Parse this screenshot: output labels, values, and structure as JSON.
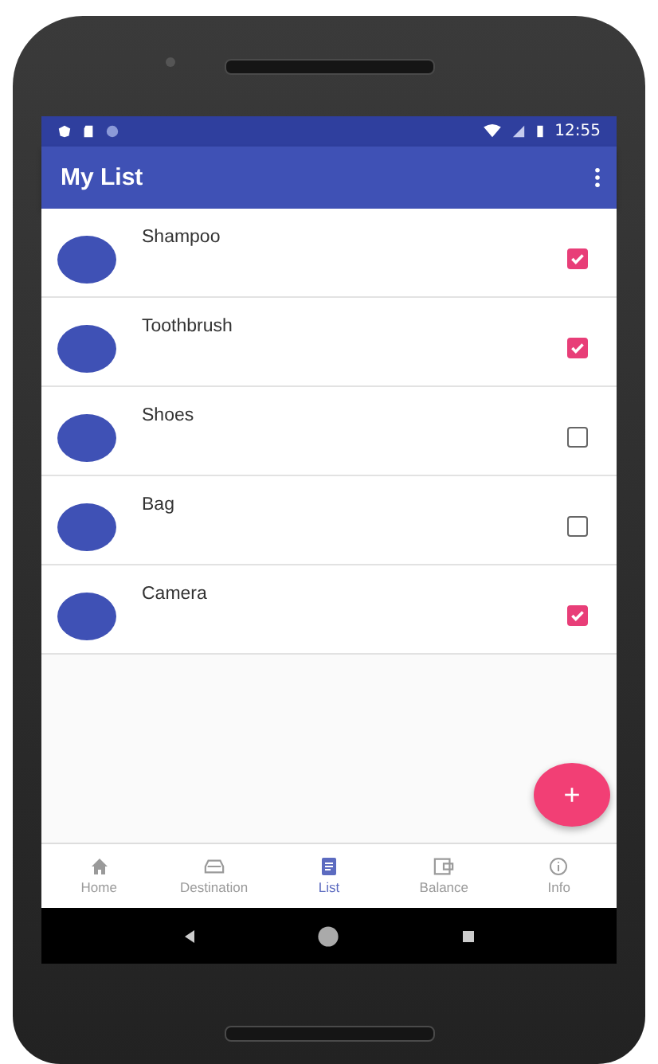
{
  "status_bar": {
    "time": "12:55"
  },
  "app_bar": {
    "title": "My List"
  },
  "items": [
    {
      "name": "Shampoo",
      "checked": true
    },
    {
      "name": "Toothbrush",
      "checked": true
    },
    {
      "name": "Shoes",
      "checked": false
    },
    {
      "name": "Bag",
      "checked": false
    },
    {
      "name": "Camera",
      "checked": true
    }
  ],
  "fab": {
    "label": "+"
  },
  "bottom_nav": [
    {
      "kind": "home",
      "label": "Home",
      "selected": false
    },
    {
      "kind": "car",
      "label": "Destination",
      "selected": false
    },
    {
      "kind": "list",
      "label": "List",
      "selected": true
    },
    {
      "kind": "wallet",
      "label": "Balance",
      "selected": false
    },
    {
      "kind": "info",
      "label": "Info",
      "selected": false
    }
  ]
}
